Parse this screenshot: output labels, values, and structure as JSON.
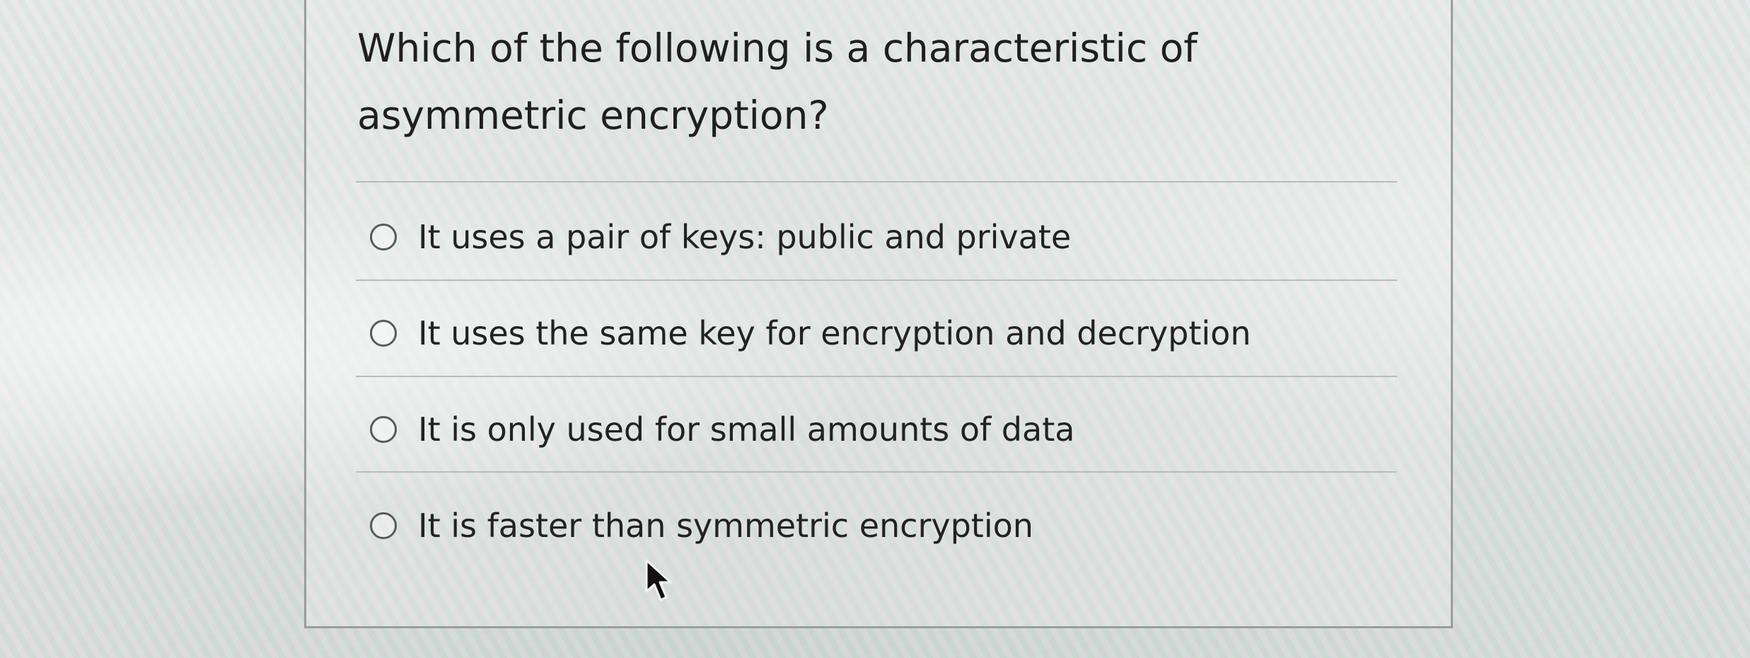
{
  "question": {
    "text": "Which of the following is a characteristic of asymmetric encryption?"
  },
  "options": [
    {
      "label": "It uses a pair of keys: public and private",
      "selected": false
    },
    {
      "label": "It uses the same key for encryption and decryption",
      "selected": false
    },
    {
      "label": "It is only used for small amounts of data",
      "selected": false
    },
    {
      "label": "It is faster than symmetric encryption",
      "selected": false
    }
  ],
  "icons": {
    "radio": "radio-unchecked-icon",
    "cursor": "mouse-pointer-icon"
  },
  "colors": {
    "border": "#9a9d9c",
    "text": "#1f1f1f",
    "radio": "#555a5b"
  }
}
